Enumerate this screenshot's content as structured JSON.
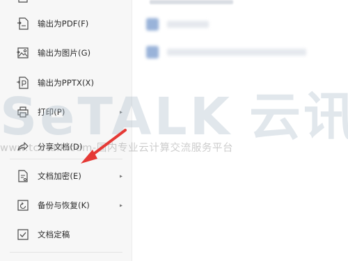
{
  "menu": {
    "items": [
      {
        "label": "输出为PDF(F)",
        "icon": "pdf-icon",
        "has_submenu": false
      },
      {
        "label": "输出为图片(G)",
        "icon": "image-icon",
        "has_submenu": false
      },
      {
        "label": "输出为PPTX(X)",
        "icon": "pptx-icon",
        "has_submenu": false
      },
      {
        "label": "打印(P)",
        "icon": "printer-icon",
        "has_submenu": true
      },
      {
        "label": "分享文档(D)",
        "icon": "share-icon",
        "has_submenu": false
      },
      {
        "label": "文档加密(E)",
        "icon": "encrypt-doc-icon",
        "has_submenu": true
      },
      {
        "label": "备份与恢复(K)",
        "icon": "backup-restore-icon",
        "has_submenu": true
      },
      {
        "label": "文档定稿",
        "icon": "finalize-doc-icon",
        "has_submenu": false
      }
    ],
    "submenu_glyph": "▸"
  },
  "watermark": {
    "brand_letters": "SeTALK",
    "brand_cn": "云讯",
    "tagline": "www.tcetalk.com-国内专业云计算交流服务平台"
  },
  "colors": {
    "menu_bg": "#f7f7f7",
    "arrow": "#e53935",
    "icon_stroke": "#4a4a4a"
  }
}
